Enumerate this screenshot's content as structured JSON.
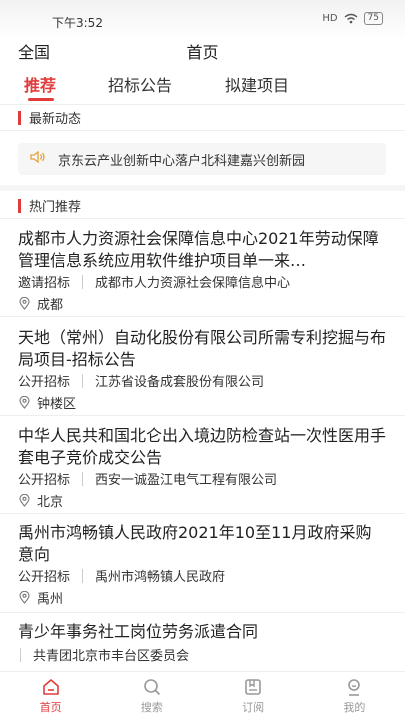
{
  "status": {
    "time": "下午3:52",
    "signal": "HD",
    "battery": "75"
  },
  "topnav": {
    "region": "全国",
    "title": "首页"
  },
  "tabs": [
    {
      "label": "推荐"
    },
    {
      "label": "招标公告"
    },
    {
      "label": "拟建项目"
    }
  ],
  "sections": {
    "latest": "最新动态",
    "hot": "热门推荐"
  },
  "notice": {
    "text": "京东云产业创新中心落户北科建嘉兴创新园"
  },
  "items": [
    {
      "title": "成都市人力资源社会保障信息中心2021年劳动保障管理信息系统应用软件维护项目单一来…",
      "type": "邀请招标",
      "org": "成都市人力资源社会保障信息中心",
      "location": "成都"
    },
    {
      "title": "天地（常州）自动化股份有限公司所需专利挖掘与布局项目-招标公告",
      "type": "公开招标",
      "org": "江苏省设备成套股份有限公司",
      "location": "钟楼区"
    },
    {
      "title": "中华人民共和国北仑出入境边防检查站一次性医用手套电子竞价成交公告",
      "type": "公开招标",
      "org": "西安一诚盈江电气工程有限公司",
      "location": "北京"
    },
    {
      "title": "禹州市鸿畅镇人民政府2021年10至11月政府采购意向",
      "type": "公开招标",
      "org": "禹州市鸿畅镇人民政府",
      "location": "禹州"
    },
    {
      "title": "青少年事务社工岗位劳务派遣合同",
      "type": "",
      "org": "共青团北京市丰台区委员会",
      "location": ""
    }
  ],
  "bottom_nav": [
    {
      "label": "首页"
    },
    {
      "label": "搜索"
    },
    {
      "label": "订阅"
    },
    {
      "label": "我的"
    }
  ],
  "colors": {
    "accent": "#e23b3b",
    "notice_icon": "#e8a23a"
  }
}
